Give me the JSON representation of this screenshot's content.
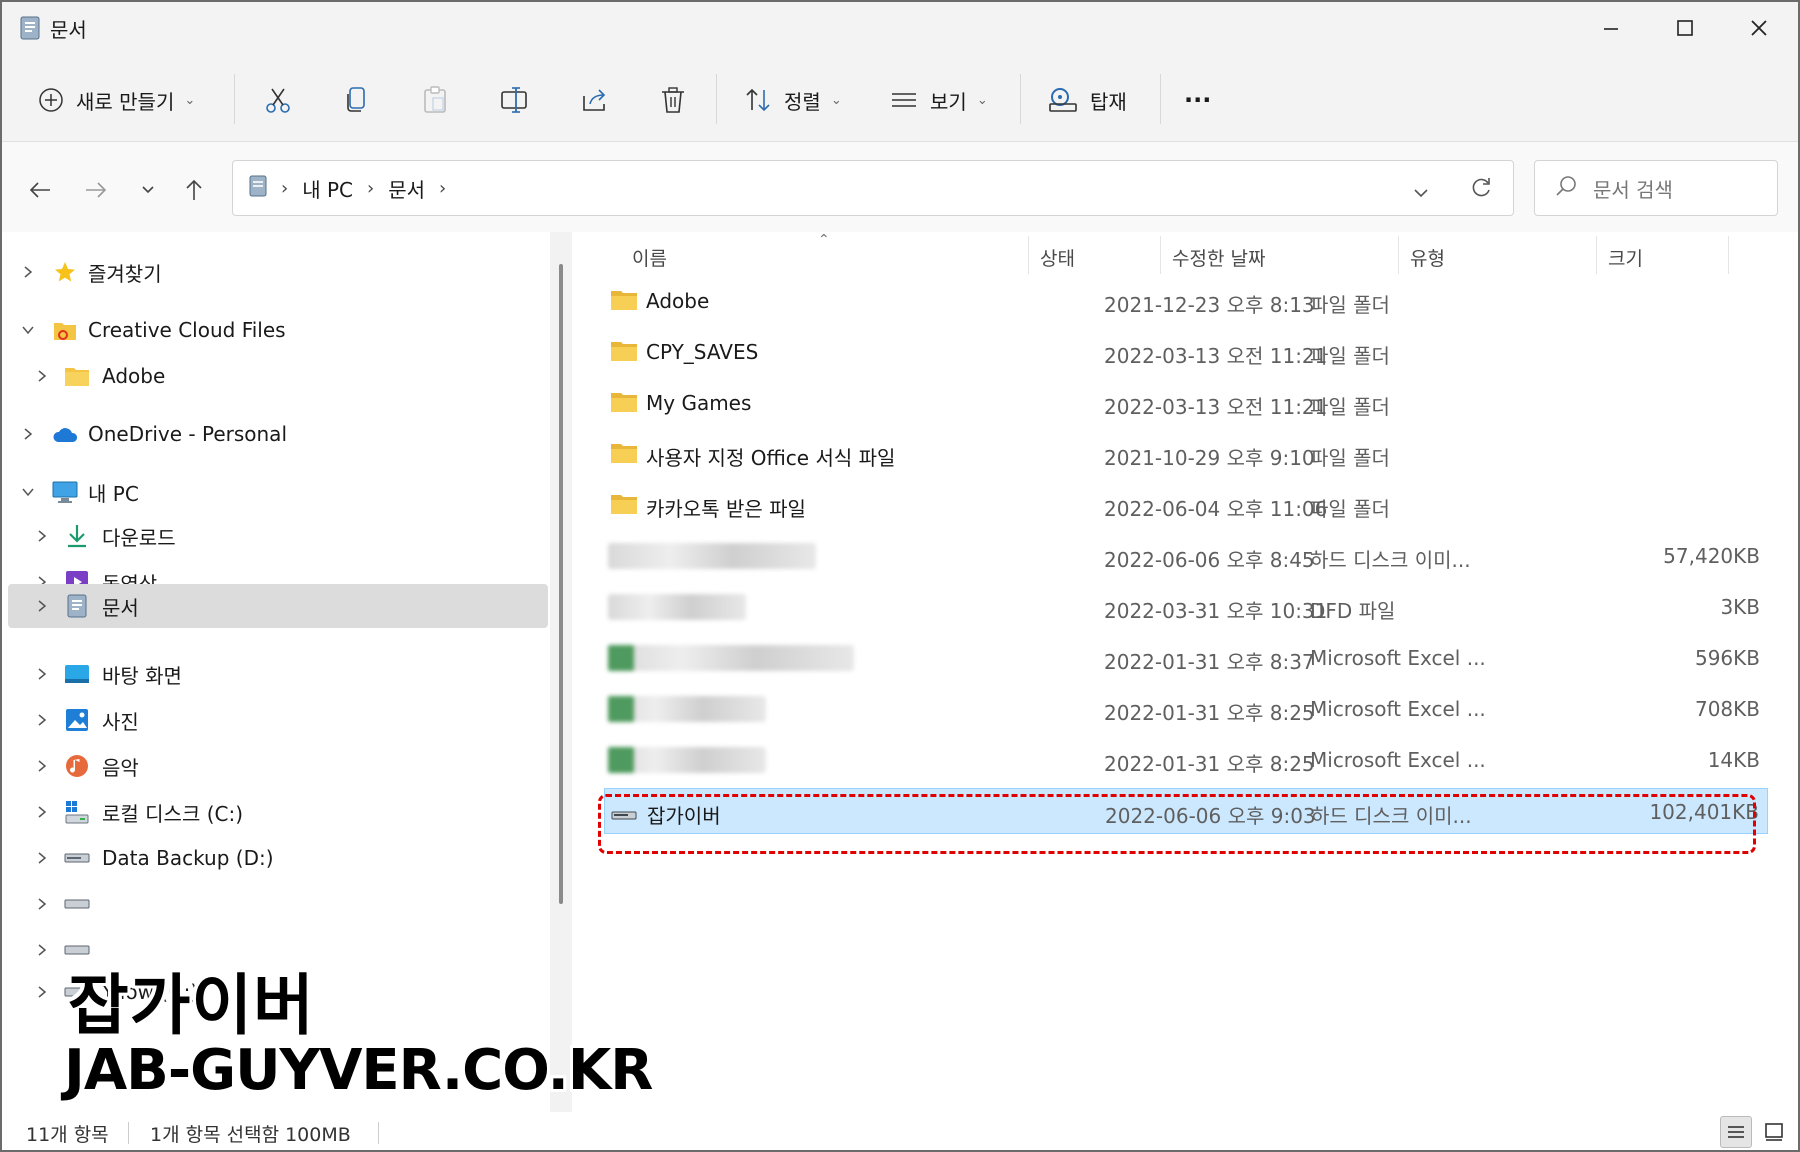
{
  "window": {
    "title": "문서",
    "icon": "documents-folder-icon"
  },
  "commandbar": {
    "new_label": "새로 만들기",
    "sort_label": "정렬",
    "view_label": "보기",
    "mount_label": "탑재",
    "more_label": "···"
  },
  "address": {
    "crumbs": [
      "내 PC",
      "문서"
    ],
    "search_placeholder": "문서 검색"
  },
  "sidebar": {
    "items": [
      {
        "label": "즐겨찾기",
        "icon": "star-icon"
      },
      {
        "label": "Creative Cloud Files",
        "icon": "creative-cloud-folder-icon"
      },
      {
        "label": "Adobe",
        "icon": "folder-icon"
      },
      {
        "label": "OneDrive - Personal",
        "icon": "cloud-icon"
      },
      {
        "label": "내 PC",
        "icon": "monitor-icon"
      },
      {
        "label": "다운로드",
        "icon": "download-icon"
      },
      {
        "label": "동영상",
        "icon": "video-icon"
      },
      {
        "label": "문서",
        "icon": "documents-icon"
      },
      {
        "label": "바탕 화면",
        "icon": "desktop-icon"
      },
      {
        "label": "사진",
        "icon": "pictures-icon"
      },
      {
        "label": "음악",
        "icon": "music-icon"
      },
      {
        "label": "로컬 디스크 (C:)",
        "icon": "system-drive-icon"
      },
      {
        "label": "Data Backup (D:)",
        "icon": "drive-icon"
      },
      {
        "label": "Yllow (G:)",
        "icon": "drive-icon"
      }
    ]
  },
  "columns": {
    "name": "이름",
    "status": "상태",
    "modified": "수정한 날짜",
    "type": "유형",
    "size": "크기"
  },
  "files": [
    {
      "name": "Adobe",
      "date": "2021-12-23 오후 8:13",
      "type": "파일 폴더",
      "size": ""
    },
    {
      "name": "CPY_SAVES",
      "date": "2022-03-13 오전 11:21",
      "type": "파일 폴더",
      "size": ""
    },
    {
      "name": "My Games",
      "date": "2022-03-13 오전 11:21",
      "type": "파일 폴더",
      "size": ""
    },
    {
      "name": "사용자 지정 Office 서식 파일",
      "date": "2021-10-29 오후 9:10",
      "type": "파일 폴더",
      "size": ""
    },
    {
      "name": "카카오톡 받은 파일",
      "date": "2022-06-04 오후 11:06",
      "type": "파일 폴더",
      "size": ""
    },
    {
      "name": "",
      "date": "2022-06-06 오후 8:45",
      "type": "하드 디스크 이미...",
      "size": "57,420KB"
    },
    {
      "name": "",
      "date": "2022-03-31 오후 10:31",
      "type": "DFD 파일",
      "size": "3KB"
    },
    {
      "name": "",
      "date": "2022-01-31 오후 8:37",
      "type": "Microsoft Excel ...",
      "size": "596KB"
    },
    {
      "name": "",
      "date": "2022-01-31 오후 8:25",
      "type": "Microsoft Excel ...",
      "size": "708KB"
    },
    {
      "name": "",
      "date": "2022-01-31 오후 8:25",
      "type": "Microsoft Excel ...",
      "size": "14KB"
    },
    {
      "name": "잡가이버",
      "date": "2022-06-06 오후 9:03",
      "type": "하드 디스크 이미...",
      "size": "102,401KB"
    }
  ],
  "status": {
    "count": "11개 항목",
    "selection": "1개 항목 선택함 100MB"
  },
  "watermark": {
    "line1": "잡가이버",
    "line2": "JAB-GUYVER.CO.KR"
  },
  "colors": {
    "selection_bg": "#cce8ff",
    "highlight_border": "#e00000",
    "folder": "#f4c542"
  }
}
